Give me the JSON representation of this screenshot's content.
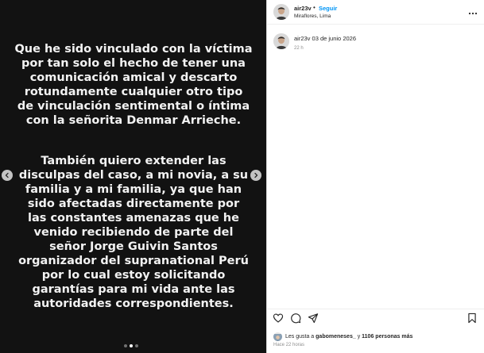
{
  "slide": {
    "paragraph1": [
      "Que he sido vinculado con la víctima",
      "por tan solo el hecho de tener una",
      "comunicación amical y descarto",
      "rotundamente cualquier otro tipo",
      "de vinculación sentimental o íntima",
      "con la señorita Denmar Arrieche."
    ],
    "paragraph2": [
      "También quiero extender las",
      "disculpas del caso, a mi novia, a su",
      "familia y a mi familia, ya que han",
      "sido afectadas directamente por",
      "las  constantes amenazas que he",
      "venido recibiendo de parte del",
      "señor Jorge Guivin Santos",
      "organizador del supranational Perú",
      "por lo cual estoy solicitando",
      "garantías para mi vida ante las",
      "autoridades correspondientes."
    ],
    "dots_total": 3,
    "dots_active_index": 1
  },
  "header": {
    "username": "air23v",
    "separator": "•",
    "follow_label": "Seguir",
    "location": "Miraflores, Lima",
    "more_icon": "more-horizontal-icon"
  },
  "caption": {
    "username": "air23v",
    "text": "03 de junio 2026",
    "time": "22 h"
  },
  "likes": {
    "prefix": "Les gusta a",
    "user": "gabomeneses_",
    "connector": "y",
    "count": "1106 personas más"
  },
  "post_time": "Hace 22 horas",
  "colors": {
    "link": "#0095f6",
    "media_bg": "#121212",
    "muted_text": "#8e8e8e"
  }
}
